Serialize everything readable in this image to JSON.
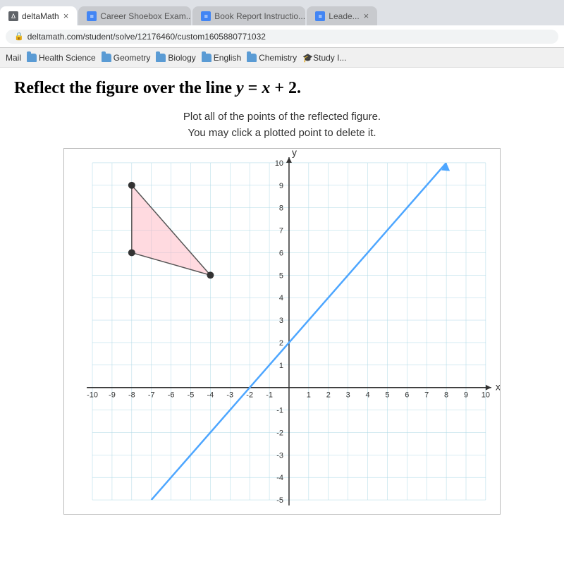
{
  "browser": {
    "tabs": [
      {
        "label": "deltaMath",
        "active": true,
        "icon": "delta"
      },
      {
        "label": "Career Shoebox Exam...",
        "active": false,
        "icon": "doc"
      },
      {
        "label": "Book Report Instructio...",
        "active": false,
        "icon": "doc"
      },
      {
        "label": "Leade...",
        "active": false,
        "icon": "doc"
      }
    ],
    "address": "deltamath.com/student/solve/12176460/custom1605880771032",
    "bookmarks": [
      "Mail",
      "Health Science",
      "Geometry",
      "Biology",
      "English",
      "Chemistry",
      "Study I..."
    ]
  },
  "problem": {
    "title": "Reflect the figure over the line y = x + 2.",
    "instructions_line1": "Plot all of the points of the reflected figure.",
    "instructions_line2": "You may click a plotted point to delete it."
  },
  "graph": {
    "x_min": -10,
    "x_max": 10,
    "y_min": -5,
    "y_max": 10,
    "line_label": "y = x + 2",
    "triangle_points": [
      {
        "x": -8,
        "y": 9
      },
      {
        "x": -8,
        "y": 6
      },
      {
        "x": -4,
        "y": 5
      }
    ]
  }
}
